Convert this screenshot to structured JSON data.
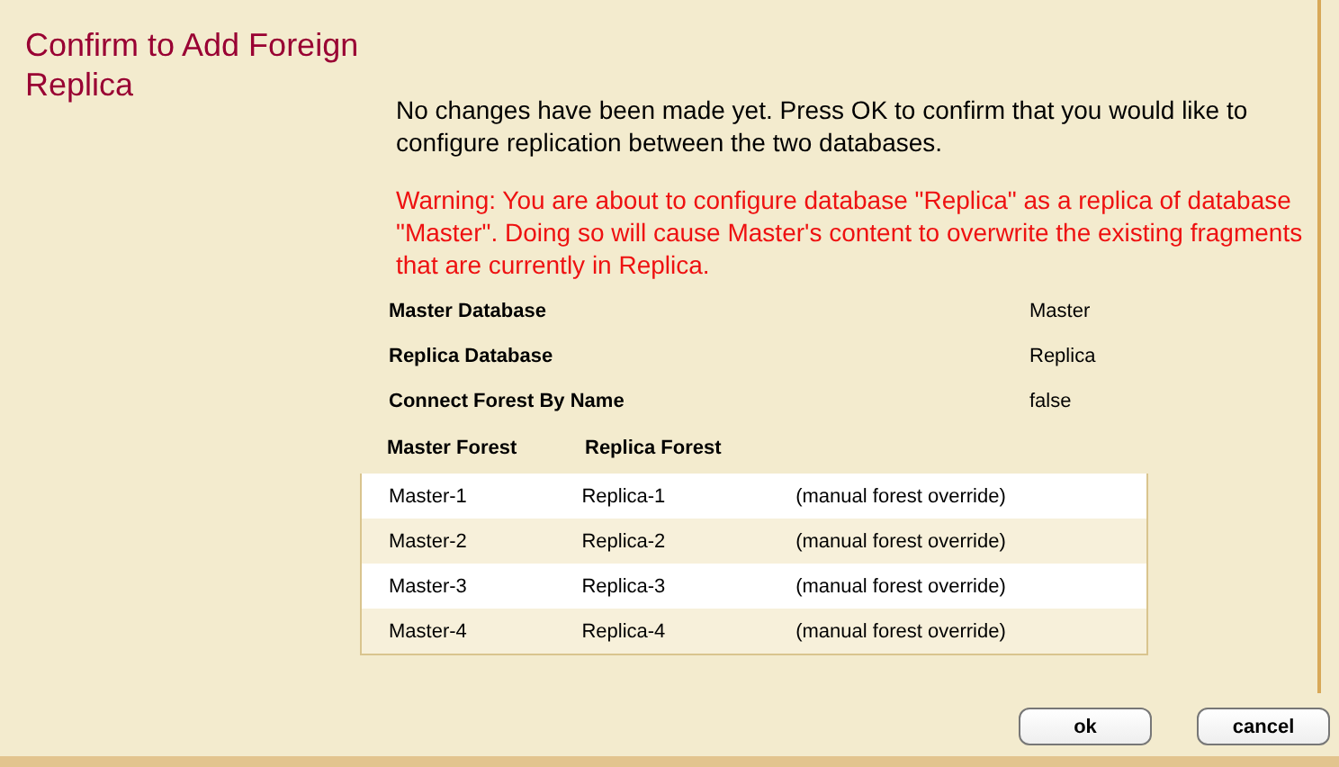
{
  "title": "Confirm to Add Foreign Replica",
  "message": "No changes have been made yet. Press OK to confirm that you would like to configure replication between the two databases.",
  "warning": "Warning: You are about to configure database \"Replica\" as a replica of database \"Master\". Doing so will cause Master's content to overwrite the existing fragments that are currently in Replica.",
  "properties": [
    {
      "label": "Master Database",
      "value": "Master"
    },
    {
      "label": "Replica Database",
      "value": "Replica"
    },
    {
      "label": "Connect Forest By Name",
      "value": "false"
    }
  ],
  "forest_table": {
    "columns": [
      "Master Forest",
      "Replica Forest"
    ],
    "rows": [
      [
        "Master-1",
        "Replica-1",
        "(manual forest override)"
      ],
      [
        "Master-2",
        "Replica-2",
        "(manual forest override)"
      ],
      [
        "Master-3",
        "Replica-3",
        "(manual forest override)"
      ],
      [
        "Master-4",
        "Replica-4",
        "(manual forest override)"
      ]
    ]
  },
  "buttons": [
    "ok",
    "cancel"
  ]
}
